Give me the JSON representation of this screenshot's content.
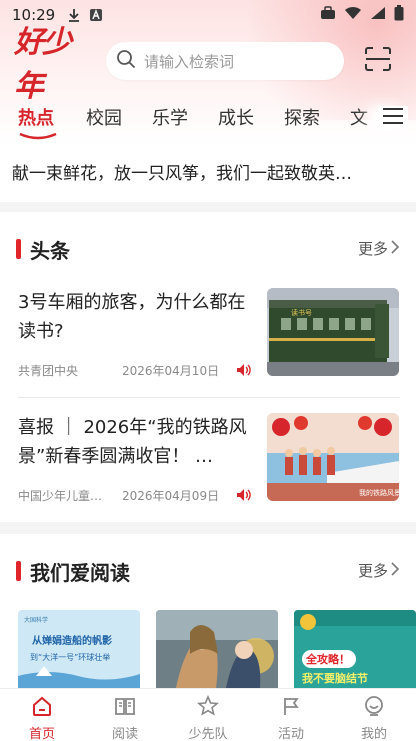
{
  "status_bar": {
    "time": "10:29"
  },
  "header": {
    "logo_text": "好少年",
    "search_placeholder": "请输入检索词"
  },
  "tabs": [
    "热点",
    "校园",
    "乐学",
    "成长",
    "探索",
    "文"
  ],
  "banner": "献一束鲜花，放一只风筝，我们一起致敬英…",
  "headlines": {
    "title": "头条",
    "more": "更多",
    "items": [
      {
        "title": "3号车厢的旅客，为什么都在读书?",
        "source": "共青团中央",
        "date": "2026年04月10日",
        "thumb_text": "读书号"
      },
      {
        "title": "喜报 ｜ 2026年“我的铁路风景”新春季圆满收官！ …",
        "source": "中国少年儿童…",
        "date": "2026年04月09日",
        "thumb_text": "我的铁路风景"
      }
    ]
  },
  "reading": {
    "title": "我们爱阅读",
    "more": "更多",
    "books": [
      {
        "title": "从婵娟造船的帆影",
        "subtitle": "到“大洋一号”环球壮举",
        "publisher": "大国科学"
      },
      {
        "title": ""
      },
      {
        "badge": "全攻略！",
        "title": "我不要脑结节"
      }
    ]
  },
  "bottom_nav": [
    {
      "label": "首页",
      "icon": "home-icon",
      "active": true
    },
    {
      "label": "阅读",
      "icon": "book-icon",
      "active": false
    },
    {
      "label": "少先队",
      "icon": "star-icon",
      "active": false
    },
    {
      "label": "活动",
      "icon": "flag-icon",
      "active": false
    },
    {
      "label": "我的",
      "icon": "profile-icon",
      "active": false
    }
  ],
  "colors": {
    "brand_red": "#d6262b",
    "accent_red": "#e0262b"
  }
}
